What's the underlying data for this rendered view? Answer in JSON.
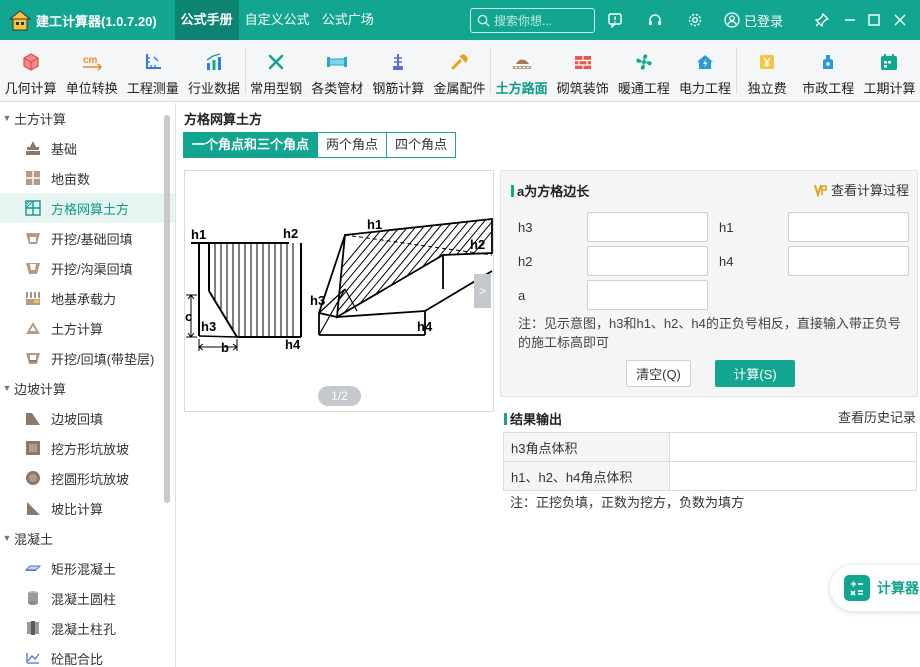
{
  "app": {
    "title": "建工计算器(1.0.7.20)",
    "tabs": [
      {
        "label": "公式手册",
        "active": true
      },
      {
        "label": "自定义公式",
        "active": false
      },
      {
        "label": "公式广场",
        "active": false
      }
    ],
    "search_placeholder": "搜索你想...",
    "login_label": "已登录",
    "accent_color": "#12a58f"
  },
  "toolbar": [
    {
      "label": "几何计算",
      "icon": "cube-icon"
    },
    {
      "label": "单位转换",
      "icon": "cm-unit-icon"
    },
    {
      "label": "工程测量",
      "icon": "measure-icon"
    },
    {
      "label": "行业数据",
      "icon": "bar-chart-icon"
    },
    {
      "label": "常用型钢",
      "icon": "steel-icon"
    },
    {
      "label": "各类管材",
      "icon": "pipe-icon"
    },
    {
      "label": "钢筋计算",
      "icon": "rebar-icon"
    },
    {
      "label": "金属配件",
      "icon": "fitting-icon"
    },
    {
      "label": "土方路面",
      "icon": "road-icon",
      "active": true
    },
    {
      "label": "砌筑装饰",
      "icon": "brick-icon"
    },
    {
      "label": "暖通工程",
      "icon": "fan-icon"
    },
    {
      "label": "电力工程",
      "icon": "power-icon"
    },
    {
      "label": "独立费",
      "icon": "fee-icon"
    },
    {
      "label": "市政工程",
      "icon": "hydrant-icon"
    },
    {
      "label": "工期计算",
      "icon": "calendar-icon"
    }
  ],
  "sidebar": {
    "groups": [
      {
        "label": "土方计算",
        "items": [
          {
            "label": "基础",
            "icon": "foundation-icon"
          },
          {
            "label": "地亩数",
            "icon": "land-grid-icon"
          },
          {
            "label": "方格网算土方",
            "icon": "grid-icon",
            "active": true
          },
          {
            "label": "开挖/基础回填",
            "icon": "excavation-icon"
          },
          {
            "label": "开挖/沟渠回填",
            "icon": "trench-icon"
          },
          {
            "label": "地基承载力",
            "icon": "bearing-icon"
          },
          {
            "label": "土方计算",
            "icon": "earth-icon"
          },
          {
            "label": "开挖/回填(带垫层)",
            "icon": "cushion-icon"
          }
        ]
      },
      {
        "label": "边坡计算",
        "items": [
          {
            "label": "边坡回填",
            "icon": "slope-icon"
          },
          {
            "label": "挖方形坑放坡",
            "icon": "square-pit-icon"
          },
          {
            "label": "挖圆形坑放坡",
            "icon": "round-pit-icon"
          },
          {
            "label": "坡比计算",
            "icon": "slope-ratio-icon"
          }
        ]
      },
      {
        "label": "混凝土",
        "items": [
          {
            "label": "矩形混凝土",
            "icon": "rect-concrete-icon"
          },
          {
            "label": "混凝土圆柱",
            "icon": "cylinder-icon"
          },
          {
            "label": "混凝土柱孔",
            "icon": "column-hole-icon"
          },
          {
            "label": "砼配合比",
            "icon": "mix-ratio-icon"
          }
        ]
      }
    ]
  },
  "main": {
    "page_title": "方格网算土方",
    "subtabs": [
      {
        "label": "一个角点和三个角点",
        "active": true
      },
      {
        "label": "两个角点",
        "active": false
      },
      {
        "label": "四个角点",
        "active": false
      }
    ],
    "diagram": {
      "pager": "1/2",
      "next": ">",
      "labels": {
        "h1": "h1",
        "h2": "h2",
        "h3": "h3",
        "h4": "h4",
        "c": "c",
        "b": "b"
      }
    },
    "input_panel": {
      "title": "a为方格边长",
      "view_steps": "查看计算过程",
      "fields": [
        {
          "label": "h3",
          "value": ""
        },
        {
          "label": "h1",
          "value": ""
        },
        {
          "label": "h2",
          "value": ""
        },
        {
          "label": "h4",
          "value": ""
        },
        {
          "label": "a",
          "value": ""
        }
      ],
      "note": "注：见示意图，h3和h1、h2、h4的正负号相反，直接输入带正负号的施工标高即可",
      "clear_label": "清空(Q)",
      "calc_label": "计算(S)"
    },
    "results": {
      "title": "结果输出",
      "history_label": "查看历史记录",
      "rows": [
        {
          "label": "h3角点体积",
          "value": ""
        },
        {
          "label": "h1、h2、h4角点体积",
          "value": ""
        }
      ],
      "note": "注：正挖负填，正数为挖方，负数为填方"
    },
    "floating_calc_label": "计算器"
  }
}
